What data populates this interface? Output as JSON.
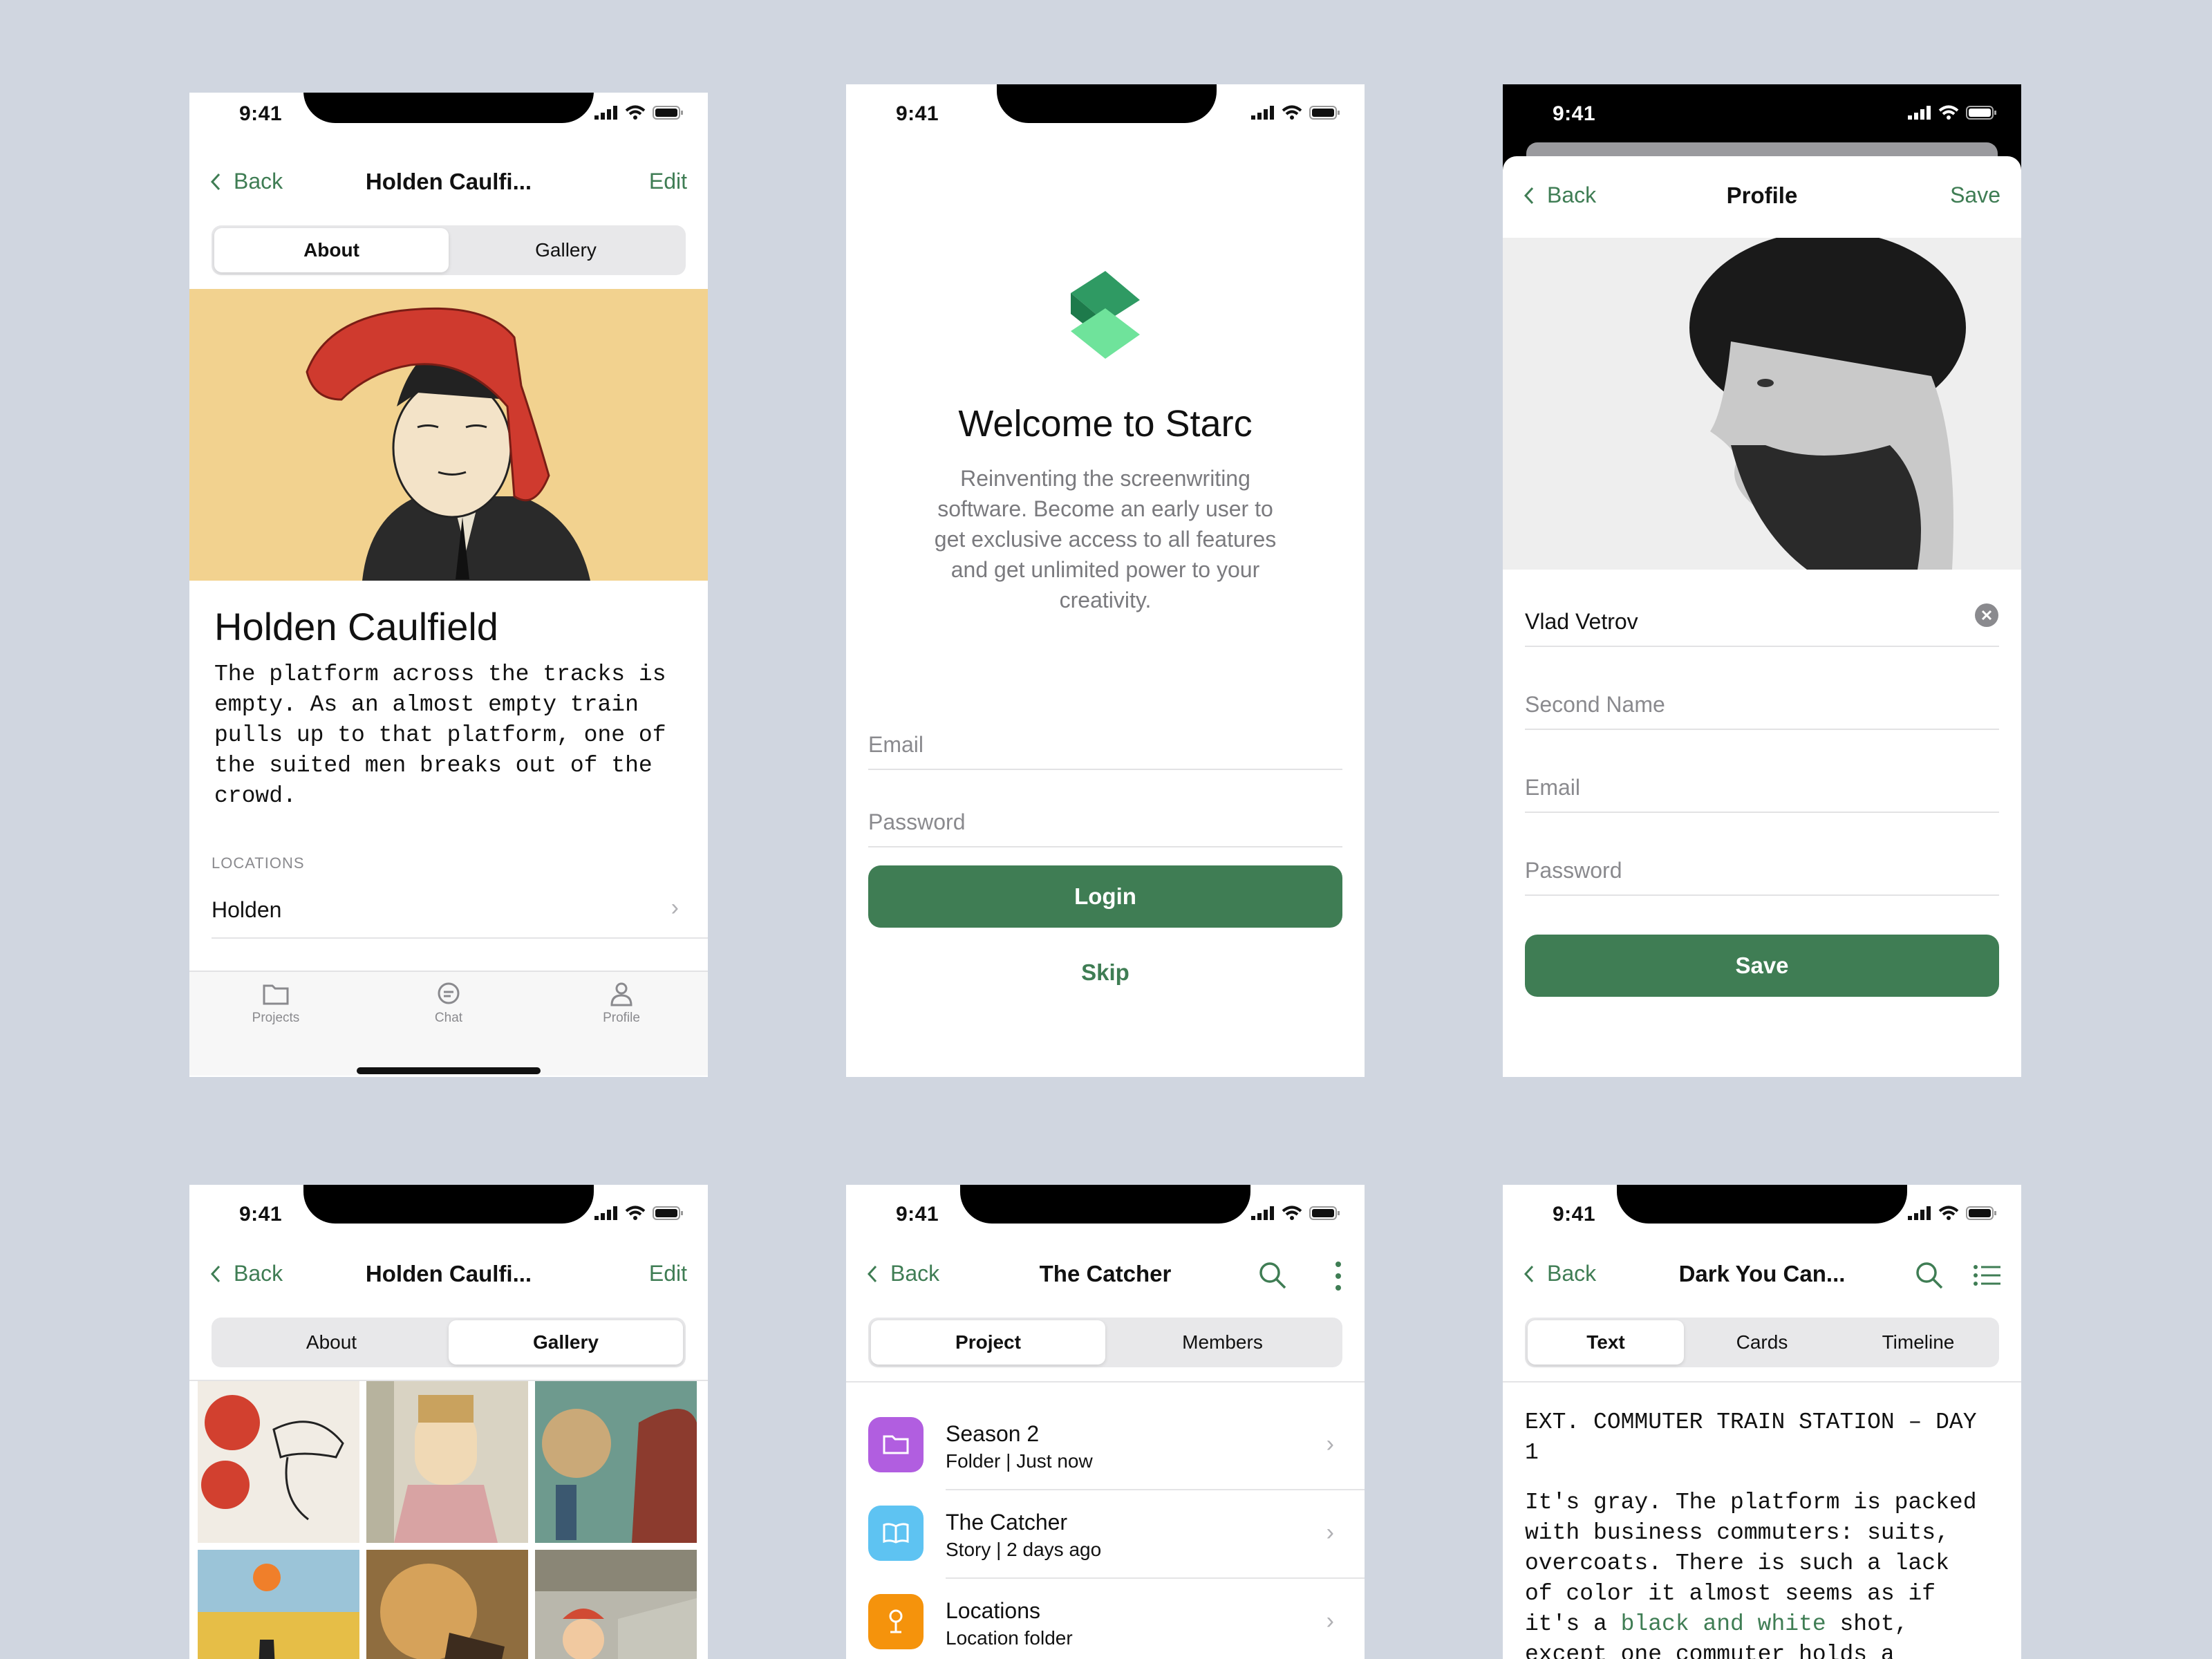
{
  "status": {
    "time": "9:41"
  },
  "screen_about": {
    "back": "Back",
    "title": "Holden Caulfi...",
    "edit": "Edit",
    "tabs": [
      "About",
      "Gallery"
    ],
    "name": "Holden Caulfield",
    "description": "The platform across the tracks is empty. As an almost empty train pulls up to that platform, one of the suited men breaks out of the crowd.",
    "section_label": "LOCATIONS",
    "location_item": "Holden",
    "tabbar": [
      "Projects",
      "Chat",
      "Profile"
    ]
  },
  "screen_welcome": {
    "title": "Welcome to Starc",
    "body": "Reinventing the screenwriting software. Become an early user to get exclusive access to all features and get unlimited power to your creativity.",
    "email_placeholder": "Email",
    "password_placeholder": "Password",
    "login": "Login",
    "skip": "Skip"
  },
  "screen_profile": {
    "back": "Back",
    "title": "Profile",
    "save_top": "Save",
    "first_name": "Vlad Vetrov",
    "second_name_placeholder": "Second Name",
    "email_placeholder": "Email",
    "password_placeholder": "Password",
    "save": "Save"
  },
  "screen_gallery": {
    "back": "Back",
    "title": "Holden Caulfi...",
    "edit": "Edit",
    "tabs": [
      "About",
      "Gallery"
    ]
  },
  "screen_project": {
    "back": "Back",
    "title": "The Catcher",
    "tabs": [
      "Project",
      "Members"
    ],
    "items": [
      {
        "title": "Season 2",
        "sub": "Folder | Just now",
        "color": "#b15ee0",
        "icon": "folder-icon"
      },
      {
        "title": "The Catcher",
        "sub": "Story | 2 days ago",
        "color": "#5ec3f2",
        "icon": "book-icon"
      },
      {
        "title": "Locations",
        "sub": "Location folder",
        "color": "#f5930c",
        "icon": "location-pin-icon"
      }
    ]
  },
  "screen_script": {
    "back": "Back",
    "title": "Dark You Can...",
    "tabs": [
      "Text",
      "Cards",
      "Timeline"
    ],
    "line1": "EXT. COMMUTER TRAIN STATION – DAY",
    "line2": "1",
    "p1": "It's gray. The platform is packed",
    "p2": "with business commuters: suits,",
    "p3": "overcoats. There is such a lack",
    "p4": "of color it almost seems as if",
    "p5a": "it's a ",
    "p5b": "black and white",
    "p5c": " shot,",
    "p6": "except one commuter holds a"
  },
  "colors": {
    "accent": "#3f7d54",
    "background": "#d0d6e0"
  }
}
